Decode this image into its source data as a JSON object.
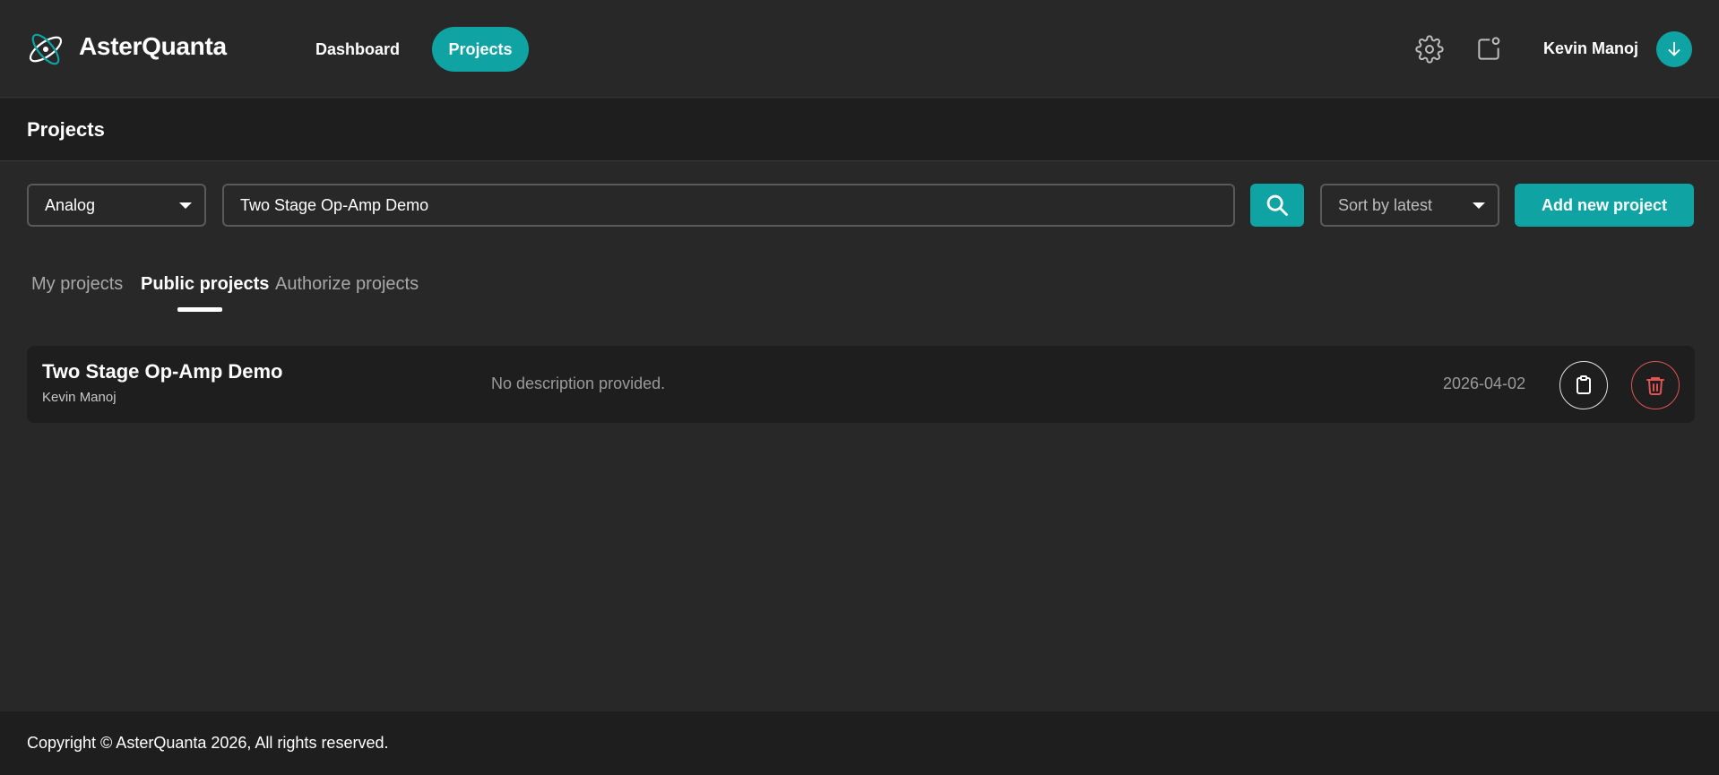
{
  "header": {
    "brand": "AsterQuanta",
    "nav": {
      "dashboard": "Dashboard",
      "projects": "Projects"
    },
    "user_name": "Kevin Manoj",
    "icons": {
      "logo": "atom-logo-icon",
      "settings": "gear-icon",
      "notifications": "notification-icon",
      "avatar": "arrow-down-icon"
    }
  },
  "page": {
    "title": "Projects"
  },
  "filters": {
    "category": "Analog",
    "search_value": "Two Stage Op-Amp Demo",
    "sort": "Sort by latest",
    "add_label": "Add new project"
  },
  "tabs": {
    "my": "My projects",
    "public": "Public projects",
    "authorize": "Authorize projects",
    "active": "Public projects"
  },
  "projects": [
    {
      "title": "Two Stage Op-Amp Demo",
      "owner": "Kevin Manoj",
      "description": "No description provided.",
      "date": "2026-04-02"
    }
  ],
  "footer": {
    "text": "Copyright © AsterQuanta 2026, All rights reserved."
  },
  "colors": {
    "accent": "#0fa3a3",
    "danger": "#e05454",
    "background": "#282828",
    "panel": "#1e1e1e"
  }
}
